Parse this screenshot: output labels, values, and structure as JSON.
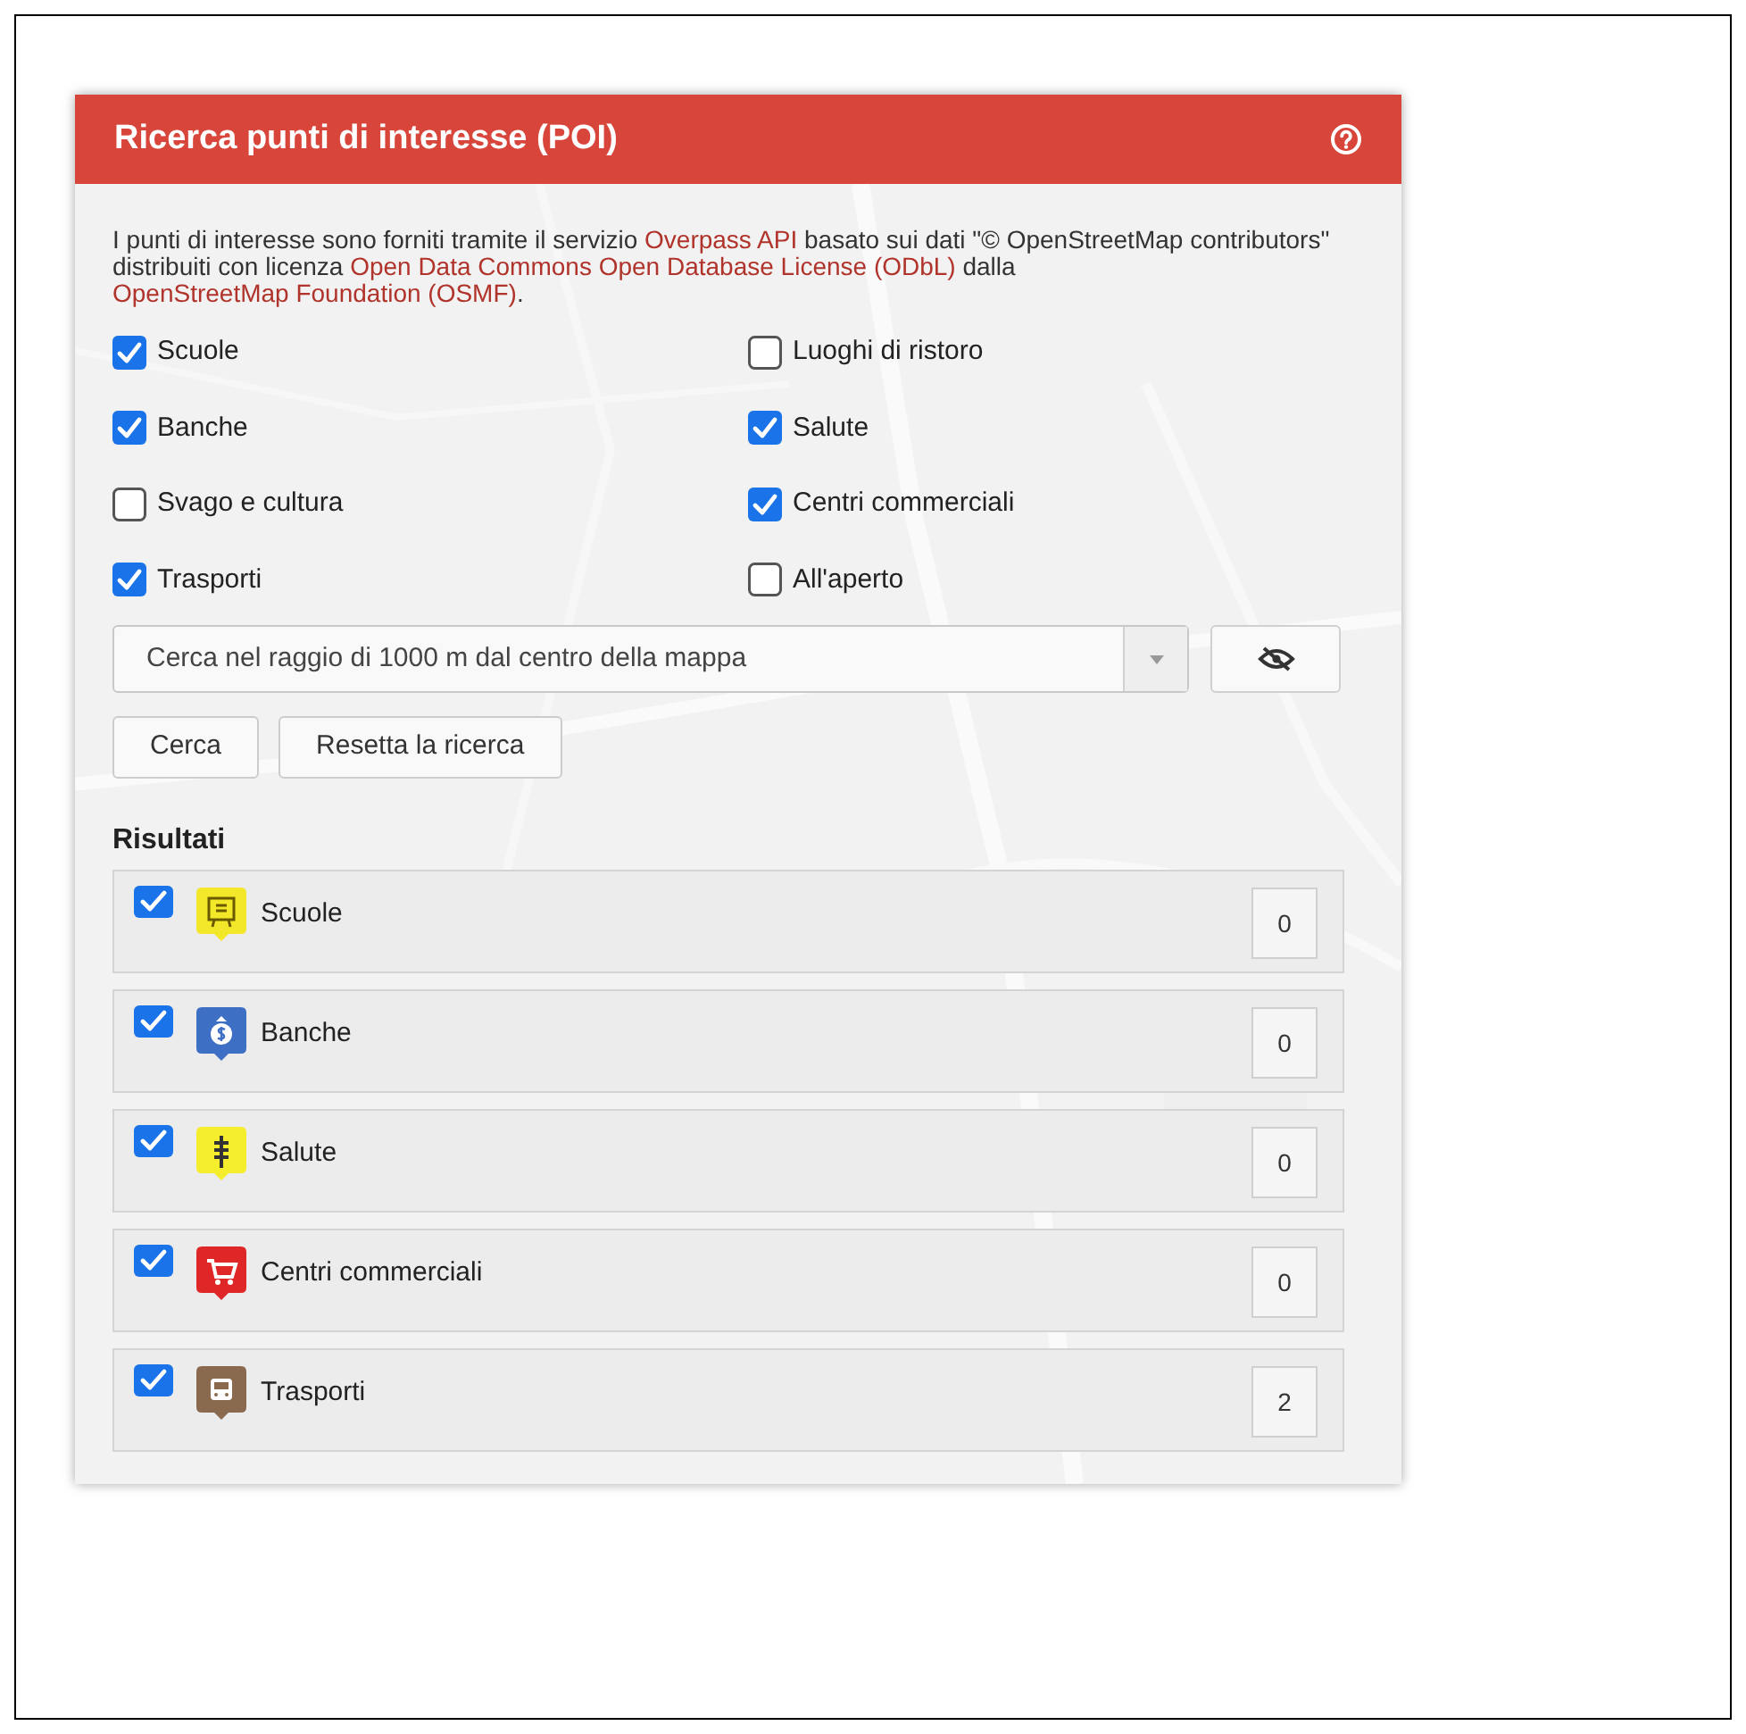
{
  "panel": {
    "title": "Ricerca punti di interesse (POI)",
    "intro": [
      {
        "text": "I punti di interesse sono forniti tramite il servizio ",
        "link": false
      },
      {
        "text": "Overpass API",
        "link": true
      },
      {
        "text": " basato sui dati \"© OpenStreetMap contributors\" distribuiti con licenza ",
        "link": false
      },
      {
        "text": "Open Data Commons Open Database License (ODbL)",
        "link": true
      },
      {
        "text": " dalla ",
        "link": false
      },
      {
        "text": "OpenStreetMap Foundation (OSMF)",
        "link": true
      },
      {
        "text": ".",
        "link": false
      }
    ],
    "categories": [
      {
        "label": "Scuole",
        "checked": true
      },
      {
        "label": "Luoghi di ristoro",
        "checked": false
      },
      {
        "label": "Banche",
        "checked": true
      },
      {
        "label": "Salute",
        "checked": true
      },
      {
        "label": "Svago e cultura",
        "checked": false
      },
      {
        "label": "Centri commerciali",
        "checked": true
      },
      {
        "label": "Trasporti",
        "checked": true
      },
      {
        "label": "All'aperto",
        "checked": false
      }
    ],
    "radius_select": {
      "value": "Cerca nel raggio di 1000 m dal centro della mappa"
    },
    "buttons": [
      "Cerca",
      "Resetta la ricerca"
    ],
    "results_heading": "Risultati",
    "results": [
      {
        "label": "Scuole",
        "checked": true,
        "kind": "school",
        "color": "#f2e829",
        "count": "0"
      },
      {
        "label": "Banche",
        "checked": true,
        "kind": "bank",
        "color": "#3d6fc4",
        "count": "0"
      },
      {
        "label": "Salute",
        "checked": true,
        "kind": "health",
        "color": "#f5ee2c",
        "count": "0"
      },
      {
        "label": "Centri commerciali",
        "checked": true,
        "kind": "shop",
        "color": "#e02727",
        "count": "0"
      },
      {
        "label": "Trasporti",
        "checked": true,
        "kind": "bus",
        "color": "#8a6a4e",
        "count": "2"
      }
    ]
  }
}
